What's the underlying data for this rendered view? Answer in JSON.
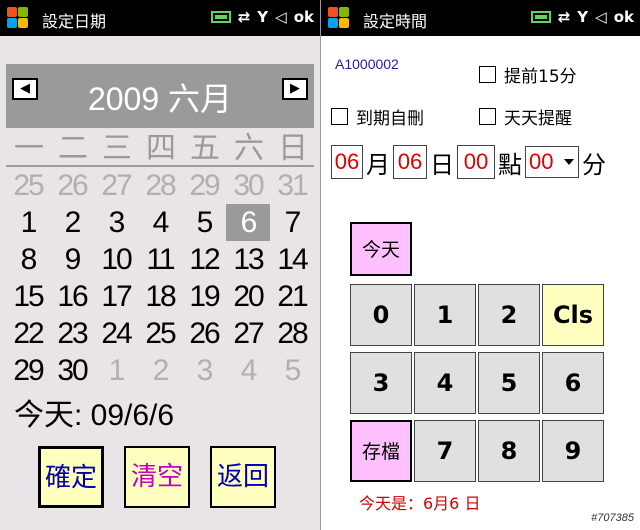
{
  "left": {
    "title": "設定日期",
    "calendar": {
      "month_label": "2009  六月",
      "weekdays": [
        "一",
        "二",
        "三",
        "四",
        "五",
        "六",
        "日"
      ],
      "rows": [
        [
          "25",
          "26",
          "27",
          "28",
          "29",
          "30",
          "31"
        ],
        [
          "1",
          "2",
          "3",
          "4",
          "5",
          "6",
          "7"
        ],
        [
          "8",
          "9",
          "10",
          "11",
          "12",
          "13",
          "14"
        ],
        [
          "15",
          "16",
          "17",
          "18",
          "19",
          "20",
          "21"
        ],
        [
          "22",
          "23",
          "24",
          "25",
          "26",
          "27",
          "28"
        ],
        [
          "29",
          "30",
          "1",
          "2",
          "3",
          "4",
          "5"
        ]
      ],
      "selected": "6"
    },
    "today_text": "今天: 09/6/6",
    "buttons": {
      "ok": "確定",
      "clear": "清空",
      "back": "返回"
    }
  },
  "right": {
    "title": "設定時間",
    "record_id": "A1000002",
    "checkboxes": {
      "advance": "提前15分",
      "auto_delete": "到期自刪",
      "daily": "天天提醒"
    },
    "time": {
      "month": "06",
      "month_unit": "月",
      "day": "06",
      "day_unit": "日",
      "hour": "00",
      "hour_unit": "點",
      "minute": "00",
      "minute_unit": "分"
    },
    "keypad": {
      "today": "今天",
      "save": "存檔",
      "cls": "Cls",
      "k0": "0",
      "k1": "1",
      "k2": "2",
      "k3": "3",
      "k4": "4",
      "k5": "5",
      "k6": "6",
      "k7": "7",
      "k8": "8",
      "k9": "9"
    },
    "status": "今天是：6月6 日"
  },
  "statusbar": {
    "ok_label": "ok",
    "data_sync": "⇄"
  },
  "watermark": "#707385",
  "colors": {
    "titlebar": "#000000",
    "calendar_header": "#9a9a9a",
    "button_yellow": "#ffffc0",
    "button_pink": "#ffc0ff",
    "time_value": "#e00000",
    "status_text": "#d00000"
  }
}
